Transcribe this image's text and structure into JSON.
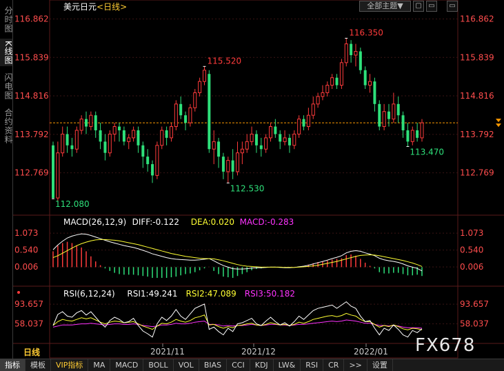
{
  "sidebar": {
    "items": [
      {
        "label": "分时图",
        "active": false
      },
      {
        "label": "K线图",
        "active": true
      },
      {
        "label": "闪电图",
        "active": false
      },
      {
        "label": "合约资料",
        "active": false
      }
    ]
  },
  "header": {
    "symbol": "美元日元",
    "period_tag": "<日线>",
    "theme_button": "全部主题▼",
    "window_buttons": [
      "▢",
      "▭",
      "▭"
    ]
  },
  "period_label": "日线",
  "watermark": "FX678",
  "toolbar": {
    "items": [
      "指标",
      "模板",
      "VIP指标",
      "MA",
      "MACD",
      "BOLL",
      "VOL",
      "BIAS",
      "CCI",
      "KDJ",
      "LW&",
      "RSI",
      "CR",
      ">>",
      "设置"
    ],
    "active_index": 0,
    "vip_index": 2
  },
  "colors": {
    "up": "#ff3b3b",
    "down": "#2ee07a",
    "axis_text": "#ff4d4d",
    "grid": "#3a1414",
    "dif_line": "#ffffff",
    "dea_line": "#ffff33",
    "rsi1": "#ffffff",
    "rsi2": "#ffff33",
    "rsi3": "#ff33ff",
    "ref_line": "#ff9900"
  },
  "chart_data": {
    "type": "candlestick",
    "price_axis": {
      "ticks": [
        "116.862",
        "115.839",
        "114.816",
        "113.792",
        "112.769"
      ],
      "ylim": [
        111.9,
        117.0
      ]
    },
    "x_labels": [
      "2021/11",
      "2021/12",
      "2022/01"
    ],
    "reference_price": 114.1,
    "annotations": {
      "low_start": "112.080",
      "high_mid": "115.520",
      "low_mid": "112.530",
      "high_top": "116.350",
      "low_end": "113.470"
    },
    "candles": [
      [
        113.5,
        112.1,
        113.6,
        112.08
      ],
      [
        112.1,
        113.3,
        113.6,
        112.0
      ],
      [
        113.3,
        113.8,
        114.0,
        113.2
      ],
      [
        113.8,
        113.5,
        114.0,
        113.3
      ],
      [
        113.5,
        113.4,
        113.7,
        113.2
      ],
      [
        113.4,
        113.9,
        114.0,
        113.3
      ],
      [
        113.9,
        114.2,
        114.3,
        113.8
      ],
      [
        114.2,
        114.0,
        114.4,
        113.8
      ],
      [
        114.0,
        114.3,
        114.4,
        113.9
      ],
      [
        114.3,
        113.9,
        114.4,
        113.7
      ],
      [
        113.9,
        113.6,
        114.1,
        113.4
      ],
      [
        113.6,
        113.3,
        113.8,
        113.1
      ],
      [
        113.3,
        113.8,
        113.9,
        113.2
      ],
      [
        113.8,
        114.0,
        114.1,
        113.6
      ],
      [
        114.0,
        113.9,
        114.1,
        113.6
      ],
      [
        113.9,
        113.6,
        114.0,
        113.5
      ],
      [
        113.6,
        113.7,
        113.8,
        113.4
      ],
      [
        113.7,
        113.9,
        114.0,
        113.6
      ],
      [
        113.9,
        113.5,
        114.0,
        113.3
      ],
      [
        113.5,
        113.2,
        113.6,
        112.9
      ],
      [
        113.2,
        113.0,
        113.4,
        112.8
      ],
      [
        113.0,
        112.7,
        113.1,
        112.5
      ],
      [
        112.7,
        113.5,
        113.6,
        112.6
      ],
      [
        113.5,
        113.9,
        114.0,
        113.4
      ],
      [
        113.9,
        113.7,
        114.0,
        113.5
      ],
      [
        113.7,
        114.0,
        114.1,
        113.6
      ],
      [
        114.0,
        114.6,
        114.7,
        113.9
      ],
      [
        114.6,
        114.3,
        114.8,
        114.2
      ],
      [
        114.3,
        114.1,
        114.4,
        113.9
      ],
      [
        114.1,
        114.5,
        114.6,
        114.0
      ],
      [
        114.5,
        114.9,
        115.0,
        114.4
      ],
      [
        114.9,
        115.2,
        115.3,
        114.8
      ],
      [
        115.2,
        115.5,
        115.6,
        115.1
      ],
      [
        115.4,
        113.4,
        115.5,
        113.3
      ],
      [
        113.4,
        113.6,
        113.9,
        113.0
      ],
      [
        113.6,
        113.2,
        113.7,
        112.9
      ],
      [
        113.2,
        112.8,
        113.3,
        112.6
      ],
      [
        112.8,
        113.1,
        113.2,
        112.5
      ],
      [
        113.1,
        112.8,
        113.4,
        112.6
      ],
      [
        112.8,
        113.3,
        113.6,
        112.7
      ],
      [
        113.3,
        113.4,
        113.6,
        113.0
      ],
      [
        113.4,
        113.6,
        113.8,
        113.3
      ],
      [
        113.6,
        113.8,
        114.0,
        113.5
      ],
      [
        113.8,
        113.5,
        113.9,
        113.3
      ],
      [
        113.5,
        113.4,
        113.7,
        113.2
      ],
      [
        113.4,
        113.7,
        113.8,
        113.3
      ],
      [
        113.7,
        114.0,
        114.1,
        113.6
      ],
      [
        114.0,
        113.8,
        114.2,
        113.7
      ],
      [
        113.8,
        113.6,
        113.9,
        113.4
      ],
      [
        113.6,
        113.7,
        113.9,
        113.5
      ],
      [
        113.7,
        113.5,
        113.8,
        113.3
      ],
      [
        113.5,
        113.8,
        113.9,
        113.4
      ],
      [
        113.8,
        114.2,
        114.3,
        113.7
      ],
      [
        114.2,
        114.0,
        114.3,
        113.9
      ],
      [
        114.0,
        114.3,
        114.5,
        113.9
      ],
      [
        114.3,
        114.6,
        114.8,
        114.2
      ],
      [
        114.6,
        114.8,
        114.9,
        114.5
      ],
      [
        114.8,
        114.9,
        115.1,
        114.7
      ],
      [
        114.9,
        115.1,
        115.2,
        114.8
      ],
      [
        115.1,
        115.3,
        115.4,
        115.0
      ],
      [
        115.3,
        115.1,
        115.4,
        115.0
      ],
      [
        115.1,
        115.7,
        115.8,
        115.0
      ],
      [
        115.7,
        116.2,
        116.35,
        115.6
      ],
      [
        116.2,
        115.9,
        116.3,
        115.7
      ],
      [
        115.9,
        116.0,
        116.2,
        115.6
      ],
      [
        116.0,
        115.5,
        116.1,
        115.4
      ],
      [
        115.5,
        115.1,
        115.6,
        115.0
      ],
      [
        115.1,
        115.2,
        115.4,
        114.9
      ],
      [
        115.2,
        114.6,
        115.3,
        114.4
      ],
      [
        114.6,
        114.0,
        114.7,
        113.9
      ],
      [
        114.0,
        114.4,
        114.6,
        113.9
      ],
      [
        114.4,
        114.2,
        114.6,
        114.0
      ],
      [
        114.2,
        114.6,
        114.9,
        114.1
      ],
      [
        114.6,
        114.3,
        114.8,
        114.1
      ],
      [
        114.3,
        113.9,
        114.4,
        113.7
      ],
      [
        113.9,
        113.6,
        114.1,
        113.47
      ],
      [
        113.6,
        113.9,
        114.0,
        113.5
      ],
      [
        113.9,
        113.7,
        114.1,
        113.6
      ],
      [
        113.7,
        114.1,
        114.2,
        113.6
      ]
    ],
    "macd": {
      "title": "MACD(26,12,9)",
      "diff_label": "DIFF:-0.122",
      "dea_label": "DEA:0.020",
      "macd_label": "MACD:-0.283",
      "ticks": [
        "1.073",
        "0.540",
        "0.006"
      ],
      "ylim": [
        -0.45,
        1.25
      ],
      "dif": [
        0.55,
        0.7,
        0.82,
        0.92,
        0.98,
        1.02,
        1.05,
        1.04,
        1.0,
        0.95,
        0.9,
        0.85,
        0.8,
        0.76,
        0.72,
        0.68,
        0.65,
        0.62,
        0.58,
        0.53,
        0.48,
        0.42,
        0.38,
        0.34,
        0.3,
        0.27,
        0.25,
        0.24,
        0.23,
        0.22,
        0.22,
        0.23,
        0.25,
        0.27,
        0.2,
        0.12,
        0.05,
        0.0,
        -0.05,
        -0.06,
        -0.06,
        -0.05,
        -0.03,
        -0.02,
        -0.02,
        -0.01,
        0.0,
        0.0,
        -0.01,
        -0.02,
        -0.02,
        -0.01,
        0.01,
        0.03,
        0.06,
        0.1,
        0.14,
        0.18,
        0.22,
        0.27,
        0.31,
        0.36,
        0.45,
        0.5,
        0.52,
        0.5,
        0.45,
        0.41,
        0.36,
        0.28,
        0.23,
        0.2,
        0.18,
        0.15,
        0.1,
        0.04,
        0.0,
        -0.04,
        -0.12
      ],
      "dea": [
        0.3,
        0.36,
        0.44,
        0.52,
        0.6,
        0.68,
        0.74,
        0.79,
        0.83,
        0.86,
        0.87,
        0.87,
        0.86,
        0.85,
        0.83,
        0.8,
        0.77,
        0.74,
        0.71,
        0.67,
        0.63,
        0.59,
        0.55,
        0.51,
        0.47,
        0.43,
        0.4,
        0.37,
        0.34,
        0.32,
        0.3,
        0.28,
        0.27,
        0.27,
        0.26,
        0.23,
        0.2,
        0.16,
        0.12,
        0.08,
        0.05,
        0.03,
        0.02,
        0.01,
        0.0,
        0.0,
        0.0,
        0.0,
        0.0,
        -0.01,
        -0.01,
        -0.01,
        0.0,
        0.01,
        0.02,
        0.04,
        0.06,
        0.09,
        0.12,
        0.15,
        0.18,
        0.22,
        0.26,
        0.3,
        0.34,
        0.37,
        0.38,
        0.39,
        0.38,
        0.36,
        0.33,
        0.3,
        0.27,
        0.24,
        0.21,
        0.17,
        0.13,
        0.08,
        0.02
      ]
    },
    "rsi": {
      "title": "RSI(6,12,24)",
      "rsi1_label": "RSI1:49.241",
      "rsi2_label": "RSI2:47.089",
      "rsi3_label": "RSI3:50.182",
      "ticks": [
        "93.657",
        "58.037"
      ],
      "ylim": [
        25,
        105
      ],
      "rsi1": [
        55,
        75,
        80,
        72,
        70,
        78,
        82,
        74,
        80,
        70,
        60,
        52,
        64,
        70,
        66,
        60,
        62,
        68,
        55,
        45,
        40,
        34,
        58,
        70,
        64,
        72,
        84,
        72,
        66,
        76,
        86,
        90,
        94,
        48,
        52,
        44,
        38,
        50,
        44,
        58,
        60,
        64,
        68,
        58,
        55,
        63,
        70,
        62,
        56,
        60,
        54,
        62,
        72,
        66,
        74,
        82,
        86,
        88,
        90,
        92,
        86,
        92,
        98,
        90,
        86,
        72,
        62,
        64,
        50,
        38,
        50,
        46,
        56,
        48,
        38,
        34,
        46,
        42,
        49
      ],
      "rsi2": [
        55,
        62,
        66,
        64,
        63,
        66,
        69,
        67,
        69,
        65,
        61,
        58,
        61,
        63,
        62,
        60,
        61,
        62,
        58,
        54,
        51,
        48,
        54,
        59,
        58,
        61,
        66,
        63,
        61,
        64,
        69,
        71,
        74,
        56,
        57,
        53,
        50,
        53,
        51,
        55,
        56,
        58,
        59,
        56,
        55,
        57,
        60,
        58,
        56,
        57,
        55,
        57,
        61,
        59,
        62,
        66,
        68,
        70,
        72,
        73,
        71,
        73,
        77,
        74,
        72,
        66,
        62,
        62,
        57,
        52,
        55,
        53,
        56,
        53,
        49,
        47,
        50,
        49,
        47
      ],
      "rsi3": [
        52,
        54,
        56,
        56,
        56,
        57,
        58,
        58,
        59,
        58,
        57,
        56,
        57,
        58,
        58,
        57,
        57,
        58,
        57,
        55,
        54,
        53,
        54,
        56,
        56,
        57,
        59,
        58,
        58,
        59,
        61,
        62,
        63,
        57,
        57,
        56,
        54,
        55,
        54,
        55,
        55,
        56,
        57,
        56,
        55,
        56,
        57,
        57,
        56,
        56,
        55,
        56,
        57,
        57,
        58,
        59,
        60,
        61,
        62,
        63,
        62,
        63,
        65,
        64,
        63,
        61,
        59,
        59,
        57,
        55,
        55,
        54,
        55,
        54,
        52,
        51,
        51,
        51,
        50
      ]
    }
  }
}
